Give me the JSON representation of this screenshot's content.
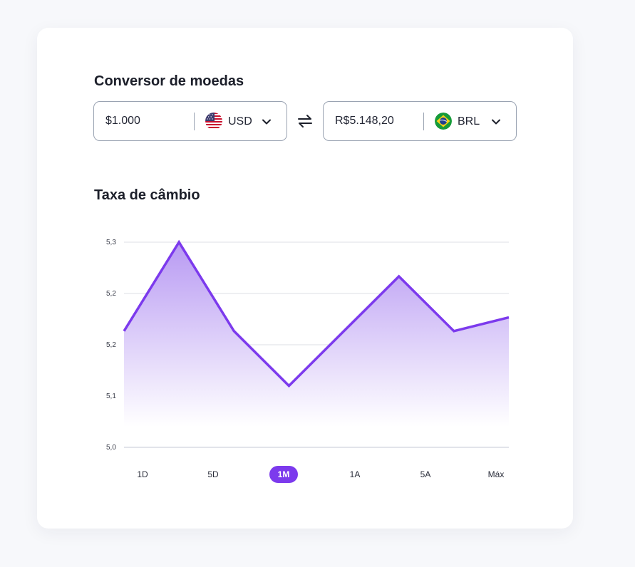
{
  "converter": {
    "title": "Conversor de moedas",
    "from": {
      "amount": "$1.000",
      "currency": "USD",
      "flag": "us-flag-icon"
    },
    "to": {
      "amount": "R$5.148,20",
      "currency": "BRL",
      "flag": "brazil-flag-icon"
    },
    "swap_icon": "swap-arrows-icon"
  },
  "rate": {
    "title": "Taxa de câmbio"
  },
  "colors": {
    "accent": "#7c3aed",
    "line": "#7c3aed",
    "fill_top": "#b89af3",
    "gridline": "#e9eaee"
  },
  "ranges": [
    {
      "label": "1D",
      "active": false
    },
    {
      "label": "5D",
      "active": false
    },
    {
      "label": "1M",
      "active": true
    },
    {
      "label": "1A",
      "active": false
    },
    {
      "label": "5A",
      "active": false
    },
    {
      "label": "Máx",
      "active": false
    }
  ],
  "chart_data": {
    "type": "area",
    "title": "",
    "xlabel": "",
    "ylabel": "",
    "y_ticks": [
      "5,0",
      "5,1",
      "5,2",
      "5,2",
      "5,3"
    ],
    "ylim": [
      5.0,
      5.3
    ],
    "grid": true,
    "series": [
      {
        "values": [
          5.17,
          5.3,
          5.17,
          5.09,
          5.17,
          5.25,
          5.17,
          5.19
        ]
      }
    ]
  }
}
